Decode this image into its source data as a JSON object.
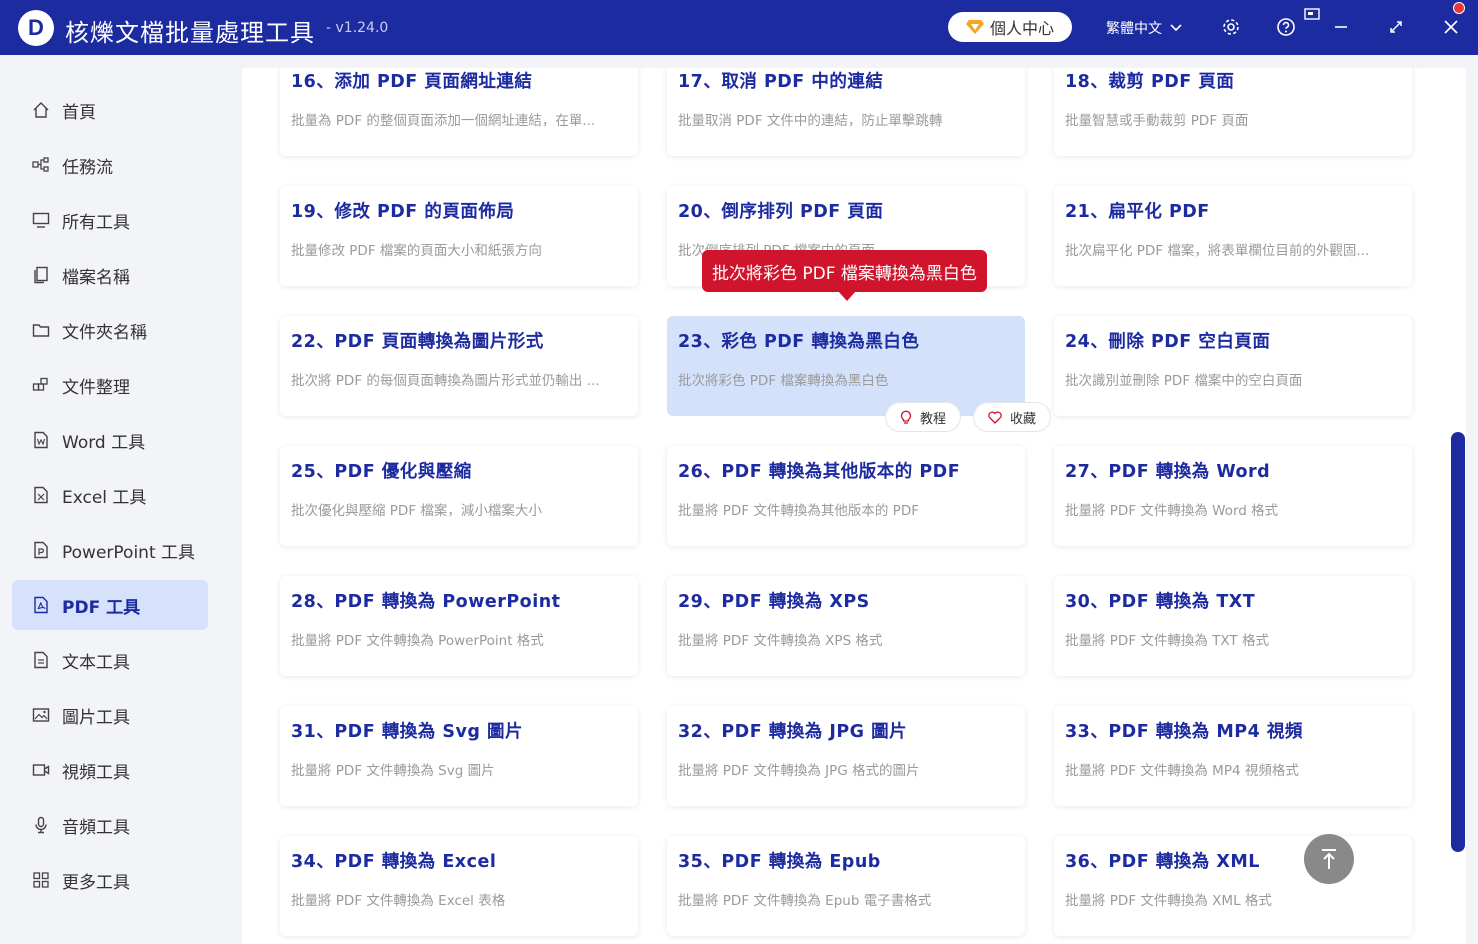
{
  "app": {
    "logo_letter": "D",
    "title": "核爍文檔批量處理工具",
    "version": "- v1.24.0"
  },
  "header": {
    "user_center": "個人中心",
    "language": "繁體中文"
  },
  "sidebar": {
    "items": [
      {
        "label": "首頁"
      },
      {
        "label": "任務流"
      },
      {
        "label": "所有工具"
      },
      {
        "label": "檔案名稱"
      },
      {
        "label": "文件夾名稱"
      },
      {
        "label": "文件整理"
      },
      {
        "label": "Word 工具"
      },
      {
        "label": "Excel 工具"
      },
      {
        "label": "PowerPoint 工具"
      },
      {
        "label": "PDF 工具"
      },
      {
        "label": "文本工具"
      },
      {
        "label": "圖片工具"
      },
      {
        "label": "視頻工具"
      },
      {
        "label": "音頻工具"
      },
      {
        "label": "更多工具"
      }
    ],
    "active": "PDF 工具"
  },
  "cards": [
    {
      "title": "16、添加 PDF 頁面網址連結",
      "desc": "批量為 PDF 的整個頁面添加一個網址連結，在單..."
    },
    {
      "title": "17、取消 PDF 中的連結",
      "desc": "批量取消 PDF 文件中的連結，防止單擊跳轉"
    },
    {
      "title": "18、裁剪 PDF 頁面",
      "desc": "批量智慧或手動裁剪 PDF 頁面"
    },
    {
      "title": "19、修改 PDF 的頁面佈局",
      "desc": "批量修改 PDF 檔案的頁面大小和紙張方向"
    },
    {
      "title": "20、倒序排列 PDF 頁面",
      "desc": "批次倒序排列 PDF 檔案中的頁面"
    },
    {
      "title": "21、扁平化 PDF",
      "desc": "批次扁平化 PDF 檔案，將表單欄位目前的外觀固..."
    },
    {
      "title": "22、PDF 頁面轉換為圖片形式",
      "desc": "批次將 PDF 的每個頁面轉換為圖片形式並仍輸出 ..."
    },
    {
      "title": "23、彩色 PDF 轉換為黑白色",
      "desc": "批次將彩色 PDF 檔案轉換為黑白色"
    },
    {
      "title": "24、刪除 PDF 空白頁面",
      "desc": "批次識別並刪除 PDF 檔案中的空白頁面"
    },
    {
      "title": "25、PDF 優化與壓縮",
      "desc": "批次優化與壓縮 PDF 檔案，減小檔案大小"
    },
    {
      "title": "26、PDF 轉換為其他版本的 PDF",
      "desc": "批量將 PDF 文件轉換為其他版本的 PDF"
    },
    {
      "title": "27、PDF 轉換為 Word",
      "desc": "批量將 PDF 文件轉換為 Word 格式"
    },
    {
      "title": "28、PDF 轉換為 PowerPoint",
      "desc": "批量將 PDF 文件轉換為 PowerPoint 格式"
    },
    {
      "title": "29、PDF 轉換為 XPS",
      "desc": "批量將 PDF 文件轉換為 XPS 格式"
    },
    {
      "title": "30、PDF 轉換為 TXT",
      "desc": "批量將 PDF 文件轉換為 TXT 格式"
    },
    {
      "title": "31、PDF 轉換為 Svg 圖片",
      "desc": "批量將 PDF 文件轉換為 Svg 圖片"
    },
    {
      "title": "32、PDF 轉換為 JPG 圖片",
      "desc": "批量將 PDF 文件轉換為 JPG 格式的圖片"
    },
    {
      "title": "33、PDF 轉換為 MP4 視頻",
      "desc": "批量將 PDF 文件轉換為 MP4 視頻格式"
    },
    {
      "title": "34、PDF 轉換為 Excel",
      "desc": "批量將 PDF 文件轉換為 Excel 表格"
    },
    {
      "title": "35、PDF 轉換為 Epub",
      "desc": "批量將 PDF 文件轉換為 Epub 電子書格式"
    },
    {
      "title": "36、PDF 轉換為 XML",
      "desc": "批量將 PDF 文件轉換為 XML 格式"
    }
  ],
  "hover_card": {
    "tooltip": "批次將彩色 PDF 檔案轉換為黑白色",
    "tutorial_label": "教程",
    "favorite_label": "收藏"
  },
  "colors": {
    "brand": "#1d2ba0",
    "tooltip": "#d0142c",
    "highlight": "#d3e1fb"
  }
}
